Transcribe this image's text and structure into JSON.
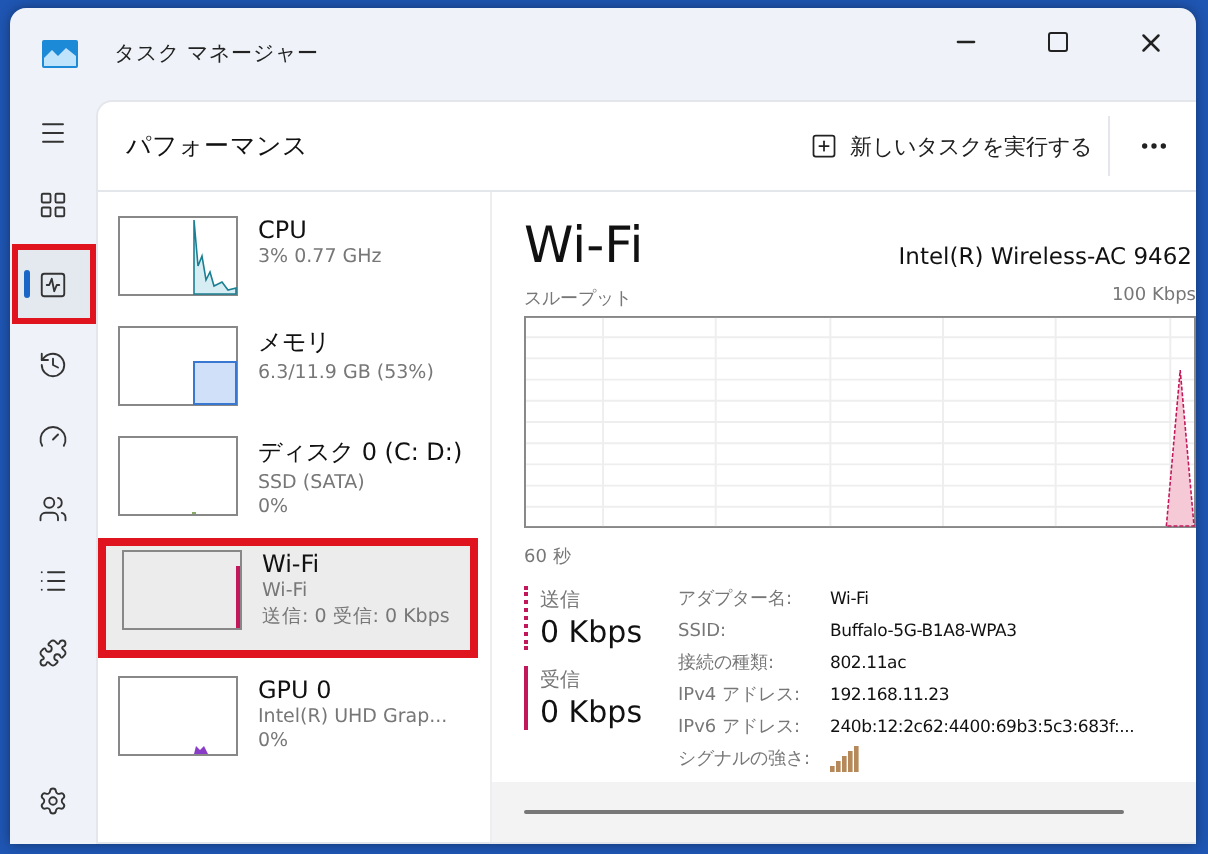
{
  "window": {
    "title": "タスク マネージャー"
  },
  "nav": [
    {
      "kind": "menu",
      "selected": false,
      "highlighted": false
    },
    {
      "kind": "processes",
      "selected": false,
      "highlighted": false
    },
    {
      "kind": "performance",
      "selected": true,
      "highlighted": true
    },
    {
      "kind": "history",
      "selected": false,
      "highlighted": false
    },
    {
      "kind": "startup",
      "selected": false,
      "highlighted": false
    },
    {
      "kind": "users",
      "selected": false,
      "highlighted": false
    },
    {
      "kind": "details",
      "selected": false,
      "highlighted": false
    },
    {
      "kind": "services",
      "selected": false,
      "highlighted": false
    },
    {
      "kind": "settings",
      "selected": false,
      "highlighted": false
    }
  ],
  "header": {
    "title": "パフォーマンス",
    "new_task": "新しいタスクを実行する"
  },
  "devices": [
    {
      "kind": "cpu",
      "name": "CPU",
      "lines": [
        "3%  0.77 GHz"
      ],
      "selected": false,
      "highlighted": false
    },
    {
      "kind": "memory",
      "name": "メモリ",
      "lines": [
        "6.3/11.9 GB (53%)"
      ],
      "selected": false,
      "highlighted": false
    },
    {
      "kind": "disk",
      "name": "ディスク 0 (C: D:)",
      "lines": [
        "SSD (SATA)",
        "0%"
      ],
      "selected": false,
      "highlighted": false
    },
    {
      "kind": "network",
      "name": "Wi-Fi",
      "lines": [
        "Wi-Fi",
        "送信: 0 受信: 0 Kbps"
      ],
      "selected": true,
      "highlighted": true
    },
    {
      "kind": "gpu",
      "name": "GPU 0",
      "lines": [
        "Intel(R) UHD Grap...",
        "0%"
      ],
      "selected": false,
      "highlighted": false
    }
  ],
  "detail": {
    "title": "Wi-Fi",
    "adapter": "Intel(R) Wireless-AC 9462",
    "throughput_label": "スループット",
    "scale_max": "100 Kbps",
    "time_span": "60 秒",
    "send": {
      "label": "送信",
      "value": "0 Kbps"
    },
    "receive": {
      "label": "受信",
      "value": "0 Kbps"
    },
    "properties": [
      {
        "kind": "text",
        "label": "アダプター名:",
        "value": "Wi-Fi"
      },
      {
        "kind": "text",
        "label": "SSID:",
        "value": "Buffalo-5G-B1A8-WPA3"
      },
      {
        "kind": "text",
        "label": "接続の種類:",
        "value": "802.11ac"
      },
      {
        "kind": "text",
        "label": "IPv4 アドレス:",
        "value": "192.168.11.23"
      },
      {
        "kind": "text",
        "label": "IPv6 アドレス:",
        "value": "240b:12:2c62:4400:69b3:5c3:683f:..."
      },
      {
        "kind": "signal",
        "label": "シグナルの強さ:"
      }
    ]
  }
}
